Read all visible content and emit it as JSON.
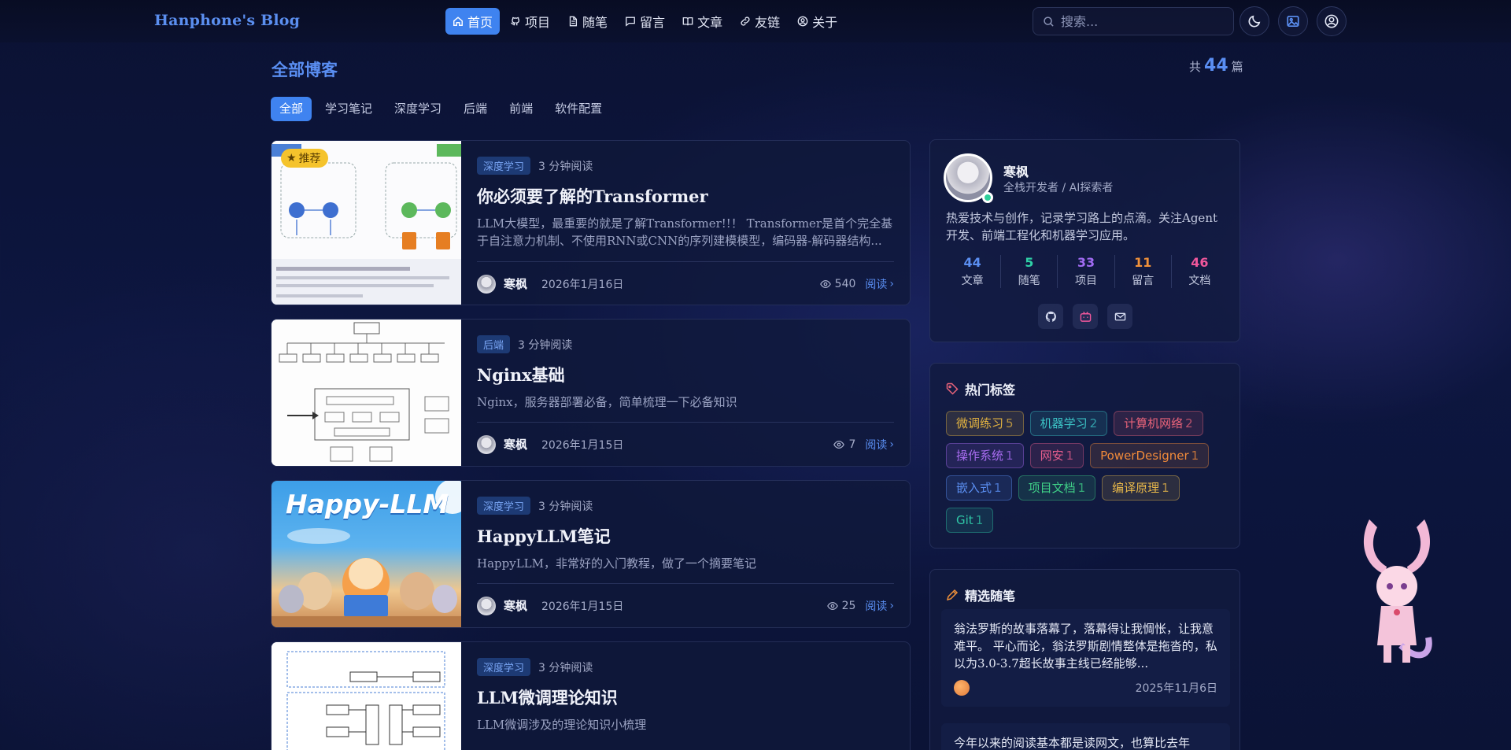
{
  "brand": "Hanphone's Blog",
  "nav": [
    {
      "label": "首页",
      "icon": "home-icon",
      "active": true
    },
    {
      "label": "项目",
      "icon": "github-icon"
    },
    {
      "label": "随笔",
      "icon": "document-icon"
    },
    {
      "label": "留言",
      "icon": "message-icon"
    },
    {
      "label": "文章",
      "icon": "book-icon"
    },
    {
      "label": "友链",
      "icon": "link-icon"
    },
    {
      "label": "关于",
      "icon": "user-circle-icon"
    }
  ],
  "search": {
    "placeholder": "搜索..."
  },
  "main": {
    "title": "全部博客",
    "count_prefix": "共",
    "count": "44",
    "count_suffix": "篇",
    "filters": [
      "全部",
      "学习笔记",
      "深度学习",
      "后端",
      "前端",
      "软件配置"
    ],
    "active_filter": "全部"
  },
  "posts": [
    {
      "badge": "推荐",
      "category": "深度学习",
      "read_time": "3 分钟阅读",
      "title": "你必须要了解的Transformer",
      "desc": "LLM大模型，最重要的就是了解Transformer!!！ Transformer是首个完全基于自注意力机制、不使用RNN或CNN的序列建模模型，编码器-解码器结构...",
      "author": "寒枫",
      "date": "2026年1月16日",
      "views": "540",
      "read": "阅读"
    },
    {
      "category": "后端",
      "read_time": "3 分钟阅读",
      "title": "Nginx基础",
      "desc": "Nginx，服务器部署必备，简单梳理一下必备知识",
      "author": "寒枫",
      "date": "2026年1月15日",
      "views": "7",
      "read": "阅读"
    },
    {
      "category": "深度学习",
      "read_time": "3 分钟阅读",
      "title": "HappyLLM笔记",
      "desc": "HappyLLM，非常好的入门教程，做了一个摘要笔记",
      "author": "寒枫",
      "date": "2026年1月15日",
      "views": "25",
      "read": "阅读",
      "thumb_text": "Happy-LLM"
    },
    {
      "category": "深度学习",
      "read_time": "3 分钟阅读",
      "title": "LLM微调理论知识",
      "desc": "LLM微调涉及的理论知识小梳理"
    }
  ],
  "profile": {
    "name": "寒枫",
    "role": "全栈开发者 / AI探索者",
    "bio": "热爱技术与创作，记录学习路上的点滴。关注Agent开发、前端工程化和机器学习应用。",
    "stats": [
      {
        "value": "44",
        "label": "文章",
        "color": "#5b8ff2"
      },
      {
        "value": "5",
        "label": "随笔",
        "color": "#2fd0a6"
      },
      {
        "value": "33",
        "label": "项目",
        "color": "#a06bf2"
      },
      {
        "value": "11",
        "label": "留言",
        "color": "#f0913a"
      },
      {
        "value": "46",
        "label": "文档",
        "color": "#f0579b"
      }
    ],
    "socials": [
      "github-icon",
      "bilibili-icon",
      "mail-icon"
    ]
  },
  "hot_tags": {
    "title": "热门标签",
    "tags": [
      {
        "name": "微调练习",
        "count": "5",
        "color": "#e3b341"
      },
      {
        "name": "机器学习",
        "count": "2",
        "color": "#3cc3c6"
      },
      {
        "name": "计算机网络",
        "count": "2",
        "color": "#e8637a"
      },
      {
        "name": "操作系统",
        "count": "1",
        "color": "#a86cf0"
      },
      {
        "name": "网安",
        "count": "1",
        "color": "#e35d8c"
      },
      {
        "name": "PowerDesigner",
        "count": "1",
        "color": "#f08a3a"
      },
      {
        "name": "嵌入式",
        "count": "1",
        "color": "#5b8ff2"
      },
      {
        "name": "项目文档",
        "count": "1",
        "color": "#3fcf87"
      },
      {
        "name": "编译原理",
        "count": "1",
        "color": "#e8b84a"
      },
      {
        "name": "Git",
        "count": "1",
        "color": "#2fc6a6"
      }
    ]
  },
  "notes": {
    "title": "精选随笔",
    "items": [
      {
        "text": "翁法罗斯的故事落幕了，落幕得让我惆怅，让我意难平。 平心而论，翁法罗斯剧情整体是拖沓的，私以为3.0-3.7超长故事主线已经能够...",
        "date": "2025年11月6日"
      },
      {
        "text": "今年以来的阅读基本都是读网文，也算比去年"
      }
    ]
  }
}
